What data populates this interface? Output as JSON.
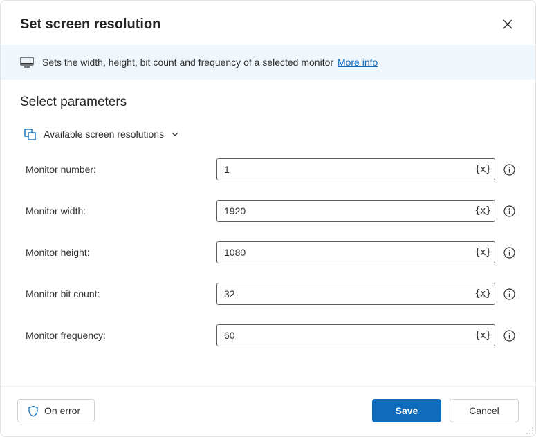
{
  "header": {
    "title": "Set screen resolution"
  },
  "banner": {
    "text": "Sets the width, height, bit count and frequency of a selected monitor",
    "link": "More info"
  },
  "section": {
    "title": "Select parameters",
    "dropdown_label": "Available screen resolutions"
  },
  "params": [
    {
      "label": "Monitor number:",
      "value": "1"
    },
    {
      "label": "Monitor width:",
      "value": "1920"
    },
    {
      "label": "Monitor height:",
      "value": "1080"
    },
    {
      "label": "Monitor bit count:",
      "value": "32"
    },
    {
      "label": "Monitor frequency:",
      "value": "60"
    }
  ],
  "footer": {
    "on_error": "On error",
    "save": "Save",
    "cancel": "Cancel"
  },
  "glyphs": {
    "fx": "{x}"
  }
}
